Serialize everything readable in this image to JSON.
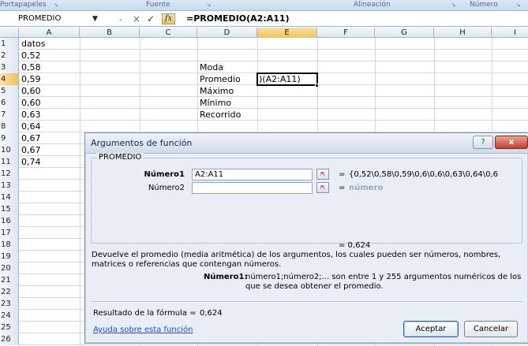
{
  "ribbon": {
    "groups": [
      "Portapapeles",
      "Fuente",
      "Alineación",
      "Número"
    ]
  },
  "formula_bar": {
    "name_box": "PROMEDIO",
    "cancel_icon": "×",
    "enter_icon": "✓",
    "fx_label": "fx",
    "formula": "=PROMEDIO(A2:A11)"
  },
  "columns": [
    "A",
    "B",
    "C",
    "D",
    "E",
    "F",
    "G",
    "H",
    "I"
  ],
  "active_column": "E",
  "rows": [
    {
      "n": "1",
      "a": "datos",
      "d": ""
    },
    {
      "n": "2",
      "a": "0,52",
      "d": ""
    },
    {
      "n": "3",
      "a": "0,58",
      "d": "Moda"
    },
    {
      "n": "4",
      "a": "0,59",
      "d": "Promedio"
    },
    {
      "n": "5",
      "a": "0,60",
      "d": "Máximo"
    },
    {
      "n": "6",
      "a": "0,60",
      "d": "Mínimo"
    },
    {
      "n": "7",
      "a": "0,63",
      "d": "Recorrido"
    },
    {
      "n": "8",
      "a": "0,64",
      "d": ""
    },
    {
      "n": "9",
      "a": "0,67",
      "d": ""
    },
    {
      "n": "10",
      "a": "0,67",
      "d": ""
    },
    {
      "n": "11",
      "a": "0,74",
      "d": ""
    },
    {
      "n": "12",
      "a": "",
      "d": ""
    },
    {
      "n": "13",
      "a": "",
      "d": ""
    },
    {
      "n": "14",
      "a": "",
      "d": ""
    },
    {
      "n": "15",
      "a": "",
      "d": ""
    },
    {
      "n": "16",
      "a": "",
      "d": ""
    },
    {
      "n": "17",
      "a": "",
      "d": ""
    },
    {
      "n": "18",
      "a": "",
      "d": ""
    },
    {
      "n": "19",
      "a": "",
      "d": ""
    },
    {
      "n": "20",
      "a": "",
      "d": ""
    },
    {
      "n": "21",
      "a": "",
      "d": ""
    },
    {
      "n": "22",
      "a": "",
      "d": ""
    },
    {
      "n": "23",
      "a": "",
      "d": ""
    },
    {
      "n": "24",
      "a": "",
      "d": ""
    },
    {
      "n": "25",
      "a": "",
      "d": ""
    },
    {
      "n": "26",
      "a": "",
      "d": ""
    }
  ],
  "active_row": "4",
  "active_cell_text": ")(A2:A11)",
  "dialog": {
    "title": "Argumentos de función",
    "help_icon": "?",
    "close_icon": "x",
    "function_name": "PROMEDIO",
    "arg1_label": "Número1",
    "arg1_value": "A2:A11",
    "arg1_result": "{0,52\\0,58\\0,59\\0,6\\0,6\\0,63\\0,64\\0,6",
    "arg2_label": "Número2",
    "arg2_value": "",
    "arg2_result": "número",
    "equals": "=",
    "result_line": "=  0,624",
    "description": "Devuelve el promedio (media aritmética) de los argumentos, los cuales pueden ser números, nombres, matrices o referencias que contengan números.",
    "arg_help_label": "Número1:",
    "arg_help_text": "número1;número2;... son entre 1 y 255 argumentos numéricos de los que se desea obtener el promedio.",
    "formula_result_label": "Resultado de la fórmula =",
    "formula_result_value": "0,624",
    "help_link": "Ayuda sobre esta función",
    "ok_button": "Aceptar",
    "cancel_button": "Cancelar",
    "collapse_icon": "⇱"
  }
}
